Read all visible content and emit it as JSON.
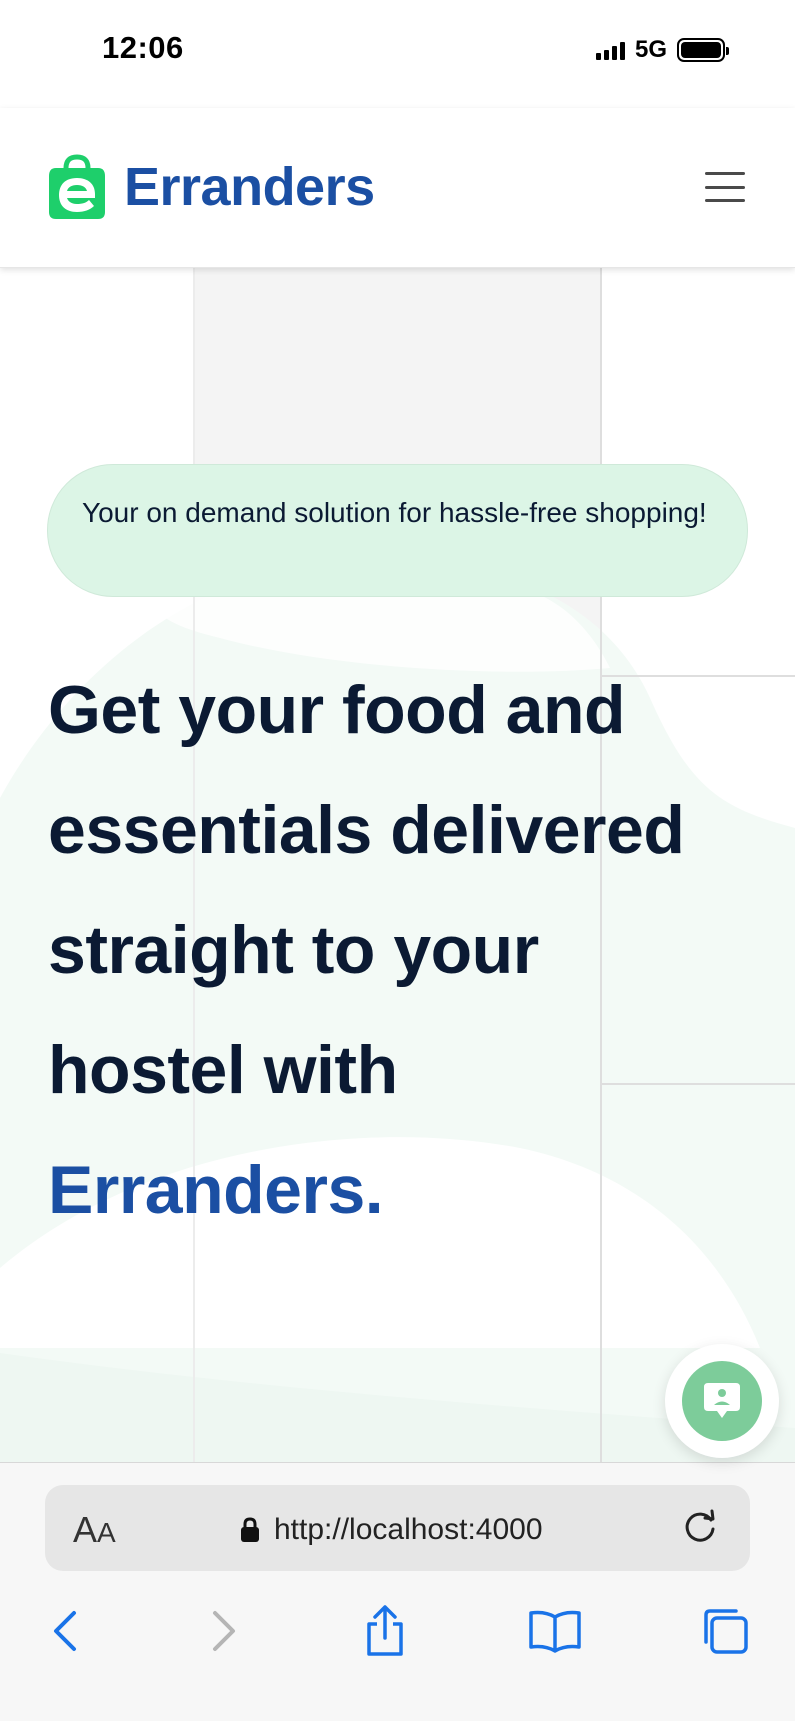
{
  "status_bar": {
    "time": "12:06",
    "network": "5G",
    "signal_icon": "signal-bars-icon",
    "battery_icon": "battery-full-icon"
  },
  "header": {
    "logo_text": "Erranders",
    "logo_icon": "shopping-bag-e-icon",
    "menu_icon": "hamburger-menu-icon"
  },
  "hero": {
    "tagline": "Your on demand solution for hassle-free shopping!",
    "headline_lines": [
      "Get your food and",
      "essentials delivered",
      "straight to your",
      "hostel with"
    ],
    "headline_brand": "Erranders."
  },
  "chat_widget": {
    "icon": "chat-bubble-icon"
  },
  "browser": {
    "text_size_label": "AA",
    "text_size_label_big": "A",
    "text_size_label_small": "A",
    "url": "http://localhost:4000",
    "lock_icon": "lock-icon",
    "reload_icon": "reload-icon",
    "toolbar": [
      "back-icon",
      "forward-icon",
      "share-icon",
      "bookmarks-icon",
      "tabs-icon"
    ]
  },
  "colors": {
    "brand_blue": "#1b4fa3",
    "brand_green": "#1ecf6b",
    "tagline_bg": "#dcf5e6",
    "chat_green": "#7dcc9a",
    "ios_blue": "#1a73e8"
  }
}
